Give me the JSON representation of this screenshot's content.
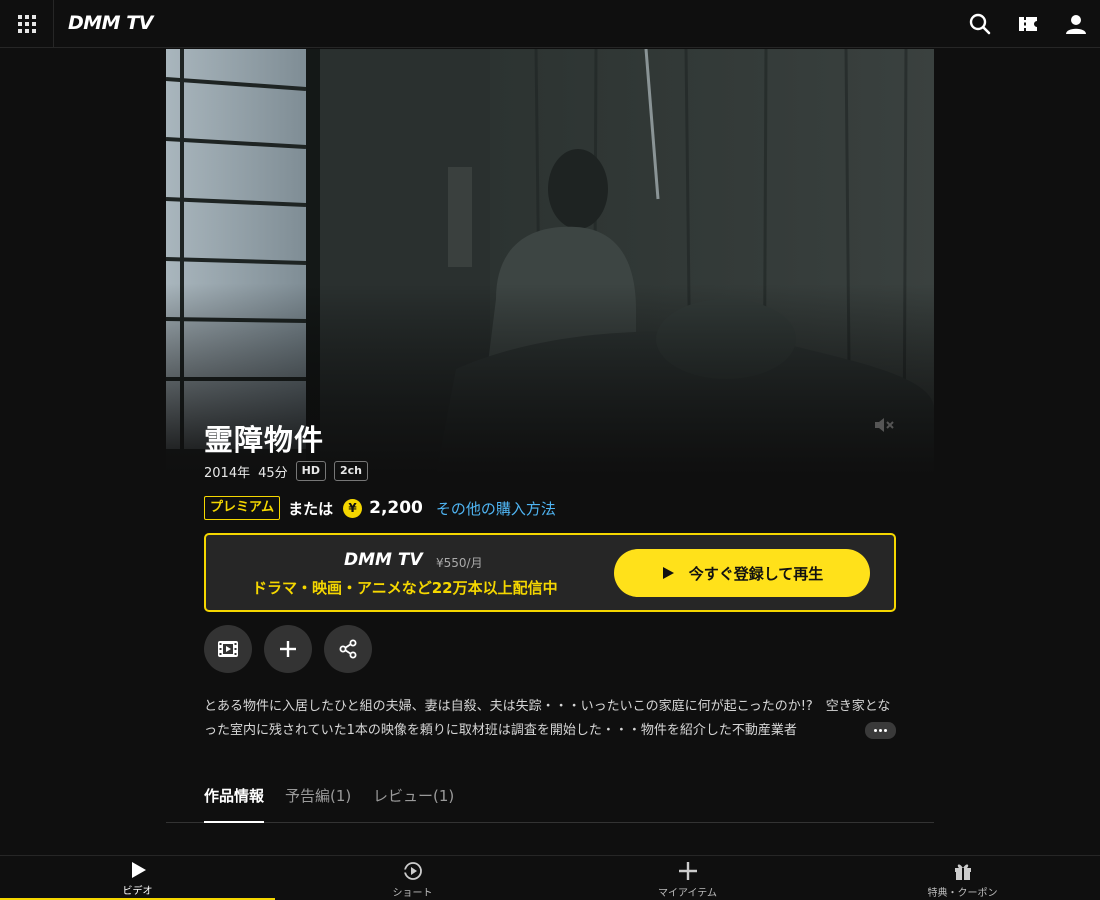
{
  "header": {
    "logo": "DMM TV",
    "icons": [
      "menu-grid-icon",
      "search-icon",
      "ticket-icon",
      "account-icon"
    ]
  },
  "hero": {
    "icon": "mute-icon"
  },
  "title": {
    "text": "霊障物件",
    "year": "2014年",
    "duration": "45分",
    "badge_hd": "HD",
    "badge_ch": "2ch"
  },
  "price": {
    "premium": "プレミアム",
    "or": "または",
    "coin_symbol": "¥",
    "amount": "2,200",
    "other_link": "その他の購入方法"
  },
  "promo": {
    "logo": "DMM TV",
    "price": "¥550/月",
    "tagline": "ドラマ・映画・アニメなど22万本以上配信中",
    "play_label": "今すぐ登録して再生"
  },
  "actions": [
    "trailer-film-icon",
    "add-icon",
    "share-icon"
  ],
  "description": {
    "text": "とある物件に入居したひと組の夫婦、妻は自殺、夫は失踪・・・いったいこの家庭に何が起こったのか!?　空き家となった室内に残されていた1本の映像を頼りに取材班は調査を開始した・・・物件を紹介した不動産業者"
  },
  "tabs": [
    {
      "label": "作品情報",
      "active": true
    },
    {
      "label": "予告編(1)",
      "active": false
    },
    {
      "label": "レビュー(1)",
      "active": false
    }
  ],
  "bottom_nav": [
    {
      "label": "ビデオ",
      "icon": "play-icon",
      "active": true
    },
    {
      "label": "ショート",
      "icon": "shorts-icon",
      "active": false
    },
    {
      "label": "マイアイテム",
      "icon": "plus-icon",
      "active": false
    },
    {
      "label": "特典・クーポン",
      "icon": "gift-icon",
      "active": false
    }
  ],
  "colors": {
    "accent": "#f5d700",
    "link": "#4fb4f2",
    "background": "#0f0f0f"
  }
}
